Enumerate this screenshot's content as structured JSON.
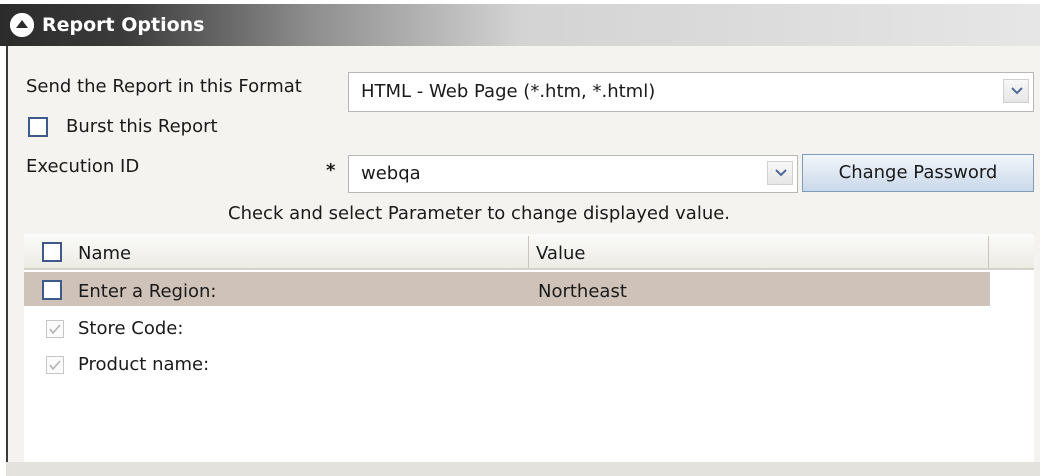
{
  "panel": {
    "title": "Report Options",
    "title_icon": "collapse-up-icon"
  },
  "format": {
    "label": "Send the Report in this Format",
    "value": "HTML - Web Page (*.htm, *.html)"
  },
  "burst": {
    "label": "Burst this Report",
    "checked": false
  },
  "execution": {
    "label": "Execution ID",
    "required_marker": "*",
    "value": "webqa",
    "change_password_label": "Change Password"
  },
  "hint": "Check and select Parameter to change displayed value.",
  "parameters": {
    "columns": [
      "Name",
      "Value"
    ],
    "rows": [
      {
        "name": "Enter a Region:",
        "value": "Northeast",
        "checked": false,
        "selected": true
      },
      {
        "name": "Store Code:",
        "value": "",
        "checked": true,
        "selected": false
      },
      {
        "name": "Product name:",
        "value": "",
        "checked": true,
        "selected": false
      }
    ]
  },
  "colors": {
    "selected_row": "#cfc2b9",
    "button_border": "#7f9db9",
    "checkbox_border": "#3d5a8a"
  }
}
